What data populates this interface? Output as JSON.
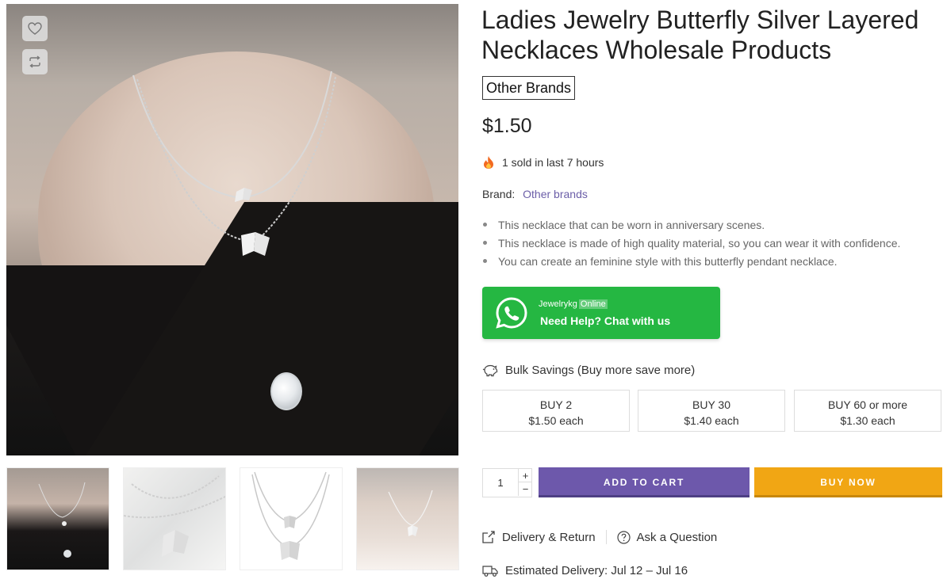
{
  "gallery": {
    "main_alt": "Ladies Jewelry Butterfly Silver Layered Necklaces",
    "wishlist_icon": "heart-icon",
    "compare_icon": "compare-arrows-icon",
    "thumbnails": [
      "thumbnail-1",
      "thumbnail-2",
      "thumbnail-3",
      "thumbnail-4"
    ]
  },
  "product": {
    "title": "Ladies Jewelry Butterfly Silver Layered Necklaces Wholesale Products",
    "vendor_badge": "Other Brands",
    "price": "$1.50",
    "sold_text": "1 sold in last 7 hours",
    "brand_label": "Brand:",
    "brand_value": "Other brands",
    "features": [
      "This necklace that can be worn in anniversary scenes.",
      "This necklace is made of high quality material, so you can wear it with confidence.",
      "You can create an feminine style with this butterfly pendant necklace."
    ]
  },
  "whatsapp": {
    "name": "Jewelrykg",
    "status": "Online",
    "help": "Need Help? Chat with us",
    "color": "#25b742"
  },
  "bulk": {
    "title": "Bulk Savings (Buy more save more)",
    "tiers": [
      {
        "label": "BUY 2",
        "price": "$1.50 each"
      },
      {
        "label": "BUY 30",
        "price": "$1.40 each"
      },
      {
        "label": "BUY 60 or more",
        "price": "$1.30 each"
      }
    ]
  },
  "cart": {
    "quantity": "1",
    "plus": "+",
    "minus": "−",
    "add_to_cart": "ADD TO CART",
    "buy_now": "BUY NOW",
    "add_color": "#6d58ab",
    "buy_color": "#f1a614"
  },
  "links": {
    "delivery_return": "Delivery & Return",
    "ask_question": "Ask a Question"
  },
  "delivery": {
    "text": "Estimated Delivery: Jul 12 – Jul 16"
  }
}
